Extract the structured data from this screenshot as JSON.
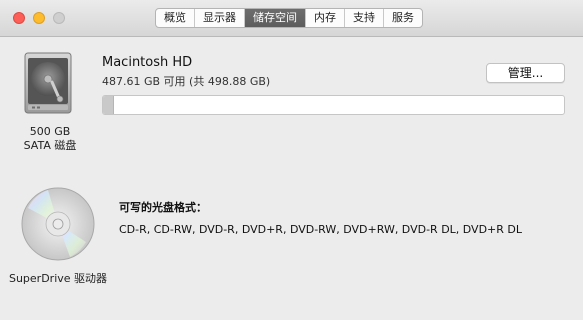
{
  "window": {
    "controls": [
      "close",
      "minimize",
      "zoom"
    ],
    "tabs": [
      {
        "label": "概览",
        "active": false
      },
      {
        "label": "显示器",
        "active": false
      },
      {
        "label": "储存空间",
        "active": true
      },
      {
        "label": "内存",
        "active": false
      },
      {
        "label": "支持",
        "active": false
      },
      {
        "label": "服务",
        "active": false
      }
    ]
  },
  "disk": {
    "icon": "hard-drive-icon",
    "capacity_label": "500 GB",
    "type_label": "SATA 磁盘",
    "name": "Macintosh HD",
    "availability": "487.61 GB 可用 (共 498.88 GB)",
    "manage_label": "管理...",
    "used_fraction": 0.022
  },
  "optical": {
    "icon": "optical-disc-icon",
    "caption": "SuperDrive 驱动器",
    "formats_label": "可写的光盘格式：",
    "formats": "CD-R, CD-RW, DVD-R, DVD+R, DVD-RW, DVD+RW, DVD-R DL, DVD+R DL"
  }
}
